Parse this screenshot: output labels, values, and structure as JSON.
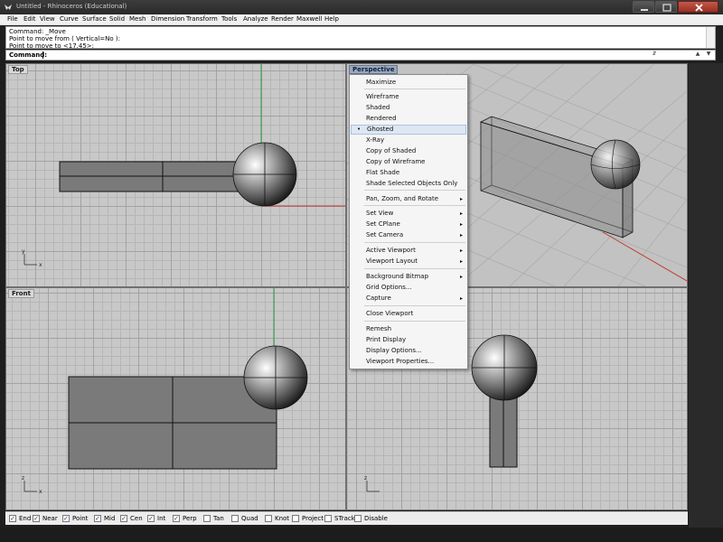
{
  "window": {
    "title": "Untitled - Rhinoceros (Educational)",
    "minimize_icon": "minimize-icon",
    "maximize_icon": "maximize-icon",
    "close_icon": "close-icon"
  },
  "menubar": {
    "items": [
      "File",
      "Edit",
      "View",
      "Curve",
      "Surface",
      "Solid",
      "Mesh",
      "Dimension",
      "Transform",
      "Tools",
      "Analyze",
      "Render",
      "Maxwell",
      "Help"
    ]
  },
  "command": {
    "history": [
      "Command: _Move",
      "Point to move from ( Vertical=No ):",
      "Point to move to <17.45>:"
    ],
    "prompt_label": "Command:",
    "value": ""
  },
  "viewports": {
    "top": {
      "label": "Top"
    },
    "front": {
      "label": "Front"
    },
    "perspective": {
      "label": "Perspective"
    },
    "right": {
      "label": ""
    }
  },
  "axis_labels": {
    "x": "x",
    "y": "y",
    "z": "z"
  },
  "context_menu": {
    "items": [
      {
        "label": "Maximize",
        "submenu": false
      },
      {
        "label": "Wireframe",
        "submenu": false
      },
      {
        "label": "Shaded",
        "submenu": false
      },
      {
        "label": "Rendered",
        "submenu": false
      },
      {
        "label": "Ghosted",
        "submenu": false,
        "checked": true,
        "selected": true
      },
      {
        "label": "X-Ray",
        "submenu": false
      },
      {
        "label": "Copy of Shaded",
        "submenu": false
      },
      {
        "label": "Copy of Wireframe",
        "submenu": false
      },
      {
        "label": "Flat Shade",
        "submenu": false
      },
      {
        "label": "Shade Selected Objects Only",
        "submenu": false
      },
      {
        "label": "Pan, Zoom, and Rotate",
        "submenu": true
      },
      {
        "label": "Set View",
        "submenu": true
      },
      {
        "label": "Set CPlane",
        "submenu": true
      },
      {
        "label": "Set Camera",
        "submenu": true
      },
      {
        "label": "Active Viewport",
        "submenu": true
      },
      {
        "label": "Viewport Layout",
        "submenu": true
      },
      {
        "label": "Background Bitmap",
        "submenu": true
      },
      {
        "label": "Grid Options...",
        "submenu": false
      },
      {
        "label": "Capture",
        "submenu": true
      },
      {
        "label": "Close Viewport",
        "submenu": false
      },
      {
        "label": "Remesh",
        "submenu": false
      },
      {
        "label": "Print Display",
        "submenu": false
      },
      {
        "label": "Display Options...",
        "submenu": false
      },
      {
        "label": "Viewport Properties...",
        "submenu": false
      }
    ]
  },
  "osnaps": [
    {
      "label": "End",
      "checked": true
    },
    {
      "label": "Near",
      "checked": true
    },
    {
      "label": "Point",
      "checked": true
    },
    {
      "label": "Mid",
      "checked": true
    },
    {
      "label": "Cen",
      "checked": true
    },
    {
      "label": "Int",
      "checked": true
    },
    {
      "label": "Perp",
      "checked": true
    },
    {
      "label": "Tan",
      "checked": false
    },
    {
      "label": "Quad",
      "checked": false
    },
    {
      "label": "Knot",
      "checked": false
    },
    {
      "label": "Project",
      "checked": false
    },
    {
      "label": "STrack",
      "checked": false
    },
    {
      "label": "Disable",
      "checked": false
    }
  ],
  "colors": {
    "viewport_bg": "#c8c8c8",
    "x_axis": "#c0392b",
    "y_axis": "#2ea043",
    "object_fill": "#7a7a7a",
    "active_tab": "#9aa7bd"
  }
}
